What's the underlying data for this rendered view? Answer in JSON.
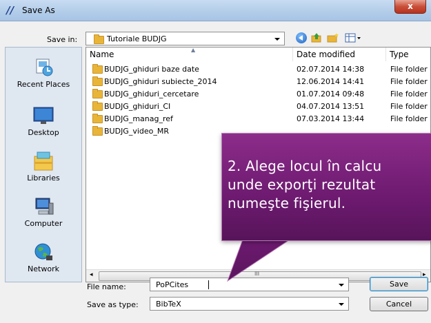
{
  "window": {
    "title": "Save As",
    "close_glyph": "x"
  },
  "save_in": {
    "label": "Save in:",
    "value": "Tutoriale BUDJG"
  },
  "places": [
    {
      "label": "Recent Places",
      "icon": "recent-places-icon"
    },
    {
      "label": "Desktop",
      "icon": "desktop-icon"
    },
    {
      "label": "Libraries",
      "icon": "libraries-icon"
    },
    {
      "label": "Computer",
      "icon": "computer-icon"
    },
    {
      "label": "Network",
      "icon": "network-icon"
    }
  ],
  "columns": {
    "name": "Name",
    "date": "Date modified",
    "type": "Type"
  },
  "files": [
    {
      "name": "BUDJG_ghiduri baze date",
      "date": "02.07.2014 14:38",
      "type": "File folder"
    },
    {
      "name": "BUDJG_ghiduri subiecte_2014",
      "date": "12.06.2014 14:41",
      "type": "File folder"
    },
    {
      "name": "BUDJG_ghiduri_cercetare",
      "date": "01.07.2014 09:48",
      "type": "File folder"
    },
    {
      "name": "BUDJG_ghiduri_CI",
      "date": "04.07.2014 13:51",
      "type": "File folder"
    },
    {
      "name": "BUDJG_manag_ref",
      "date": "07.03.2014 13:44",
      "type": "File folder"
    },
    {
      "name": "BUDJG_video_MR",
      "date": "",
      "type": ""
    }
  ],
  "file_name": {
    "label": "File name:",
    "value": "PoPCites"
  },
  "save_type": {
    "label": "Save as type:",
    "value": "BibTeX"
  },
  "buttons": {
    "save": "Save",
    "cancel": "Cancel"
  },
  "callout": {
    "text": "2. Alege locul în calcu\nunde exporţi rezultat\nnumeşte fişierul."
  },
  "scroll_glyph": "III",
  "colors": {
    "callout": "#6d1a70",
    "titlebar": "#b3cde9",
    "close": "#c94f39"
  }
}
